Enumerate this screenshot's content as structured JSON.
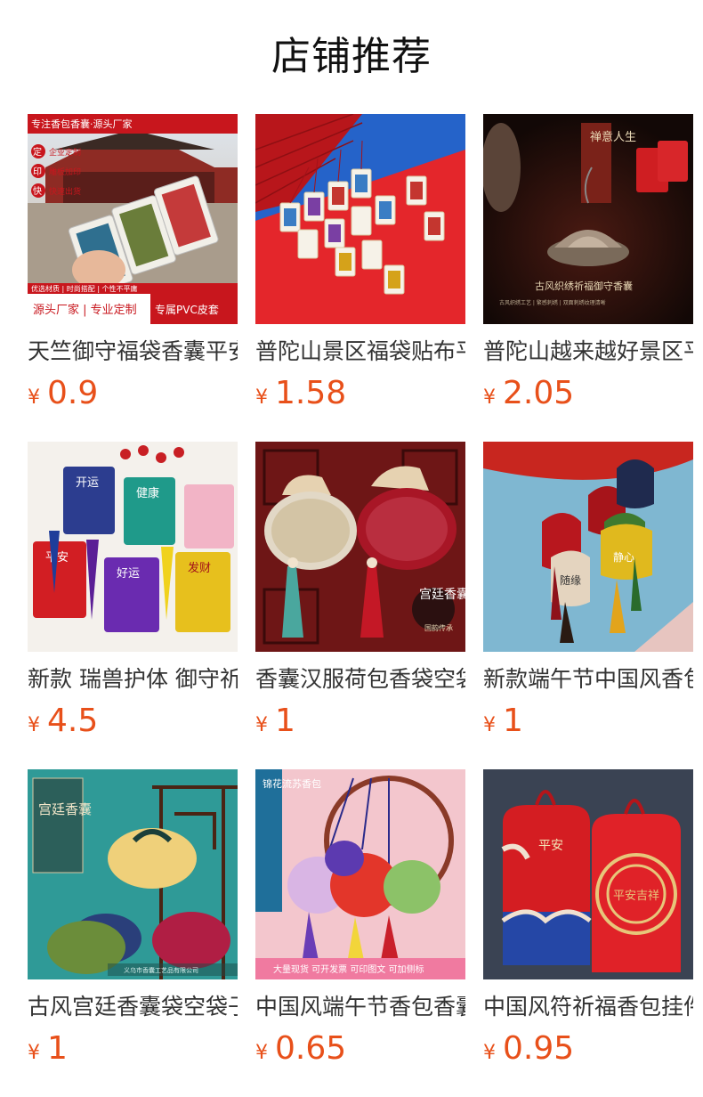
{
  "page": {
    "title": "店铺推荐"
  },
  "accent_color": "#e8501a",
  "products": [
    {
      "name": "天竺御守福袋香囊平安符",
      "currency": "¥",
      "price": "0.9",
      "image": {
        "icon": "amulet-sachets-photo",
        "top_banner": "专注香包香囊·源头厂家",
        "badges": [
          "定",
          "印",
          "快"
        ],
        "badge_texts": [
          "企业定制",
          "雕板加印",
          "快速出货"
        ],
        "strip": "优选材质 | 时尚搭配 | 个性不平庸",
        "footer_left": "源头厂家 | 专业定制",
        "footer_right": "专属PVC皮套"
      }
    },
    {
      "name": "普陀山景区福袋贴布平安",
      "currency": "¥",
      "price": "1.58",
      "image": {
        "icon": "red-fan-amulets-photo"
      }
    },
    {
      "name": "普陀山越来越好景区平安",
      "currency": "¥",
      "price": "2.05",
      "image": {
        "icon": "incense-lotus-photo",
        "vertical_text": "禅意人生",
        "caption": "古风织绣祈福御守香囊",
        "subcaption": "古风织绣工艺 | 繁感刺绣 | 双面刺绣纹理清晰"
      }
    },
    {
      "name": "新款 瑞兽护体 御守祈福",
      "currency": "¥",
      "price": "4.5",
      "image": {
        "icon": "beast-amulets-photo",
        "labels": [
          "开运",
          "健康",
          "平安",
          "好运",
          "发财"
        ]
      }
    },
    {
      "name": "香囊汉服荷包香袋空袋",
      "currency": "¥",
      "price": "1",
      "image": {
        "icon": "hanfu-sachet-photo",
        "seal": "宫廷香囊",
        "seal_small": "国韵传承"
      }
    },
    {
      "name": "新款端午节中国风香包",
      "currency": "¥",
      "price": "1",
      "image": {
        "icon": "tassel-pouches-photo",
        "labels": [
          "随缘",
          "静心"
        ]
      }
    },
    {
      "name": "古风宫廷香囊袋空袋子",
      "currency": "¥",
      "price": "1",
      "image": {
        "icon": "palace-sachets-photo",
        "panel": "宫廷香囊",
        "watermark": "义乌市香囊工艺品有限公司"
      }
    },
    {
      "name": "中国风端午节香包香囊",
      "currency": "¥",
      "price": "0.65",
      "image": {
        "icon": "colorful-pouches-photo",
        "vertical_text": "锦花流苏香包",
        "footer": "大量现货  可开发票  可印图文  可加侧标"
      }
    },
    {
      "name": "中国风符祈福香包挂件",
      "currency": "¥",
      "price": "0.95",
      "image": {
        "icon": "red-ping-an-pouches-photo",
        "left_text": "平安",
        "right_text": "平安吉祥"
      }
    }
  ]
}
